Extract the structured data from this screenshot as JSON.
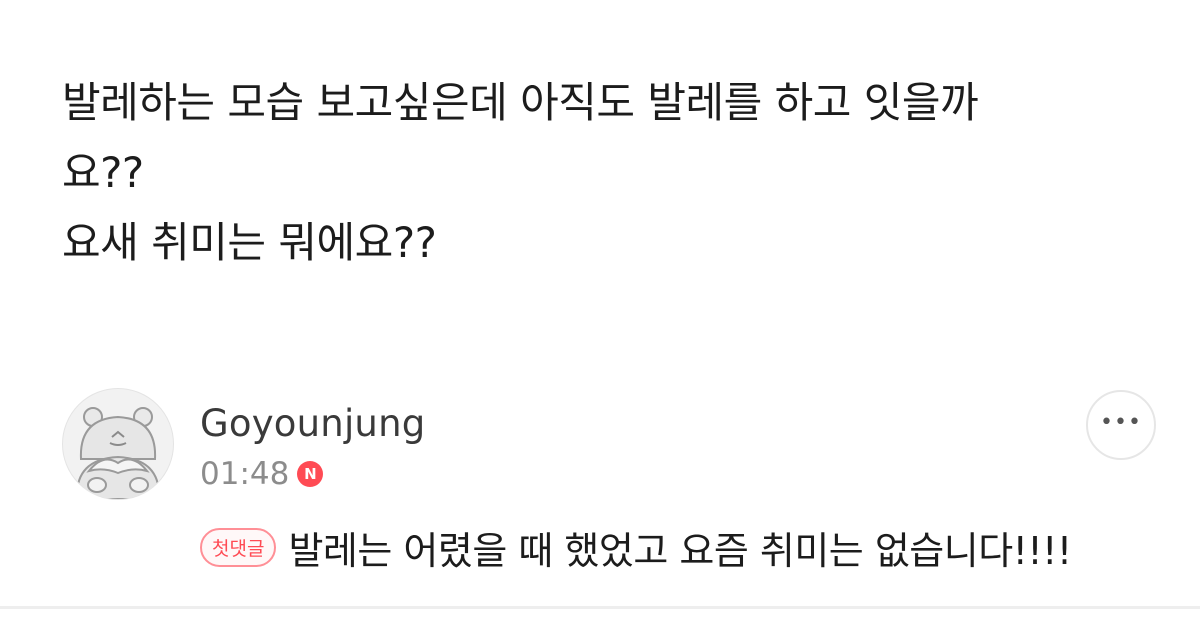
{
  "post": {
    "lines": [
      "발레하는 모습 보고싶은데 아직도 발레를 하고 잇을까",
      "요??",
      "요새 취미는 뭐에요??"
    ]
  },
  "comment": {
    "author": "Goyounjung",
    "time": "01:48",
    "new_badge": "N",
    "first_comment_badge": "첫댓글",
    "text": "발레는 어렸을 때 했었고 요즘 취미는 없습니다!!!!",
    "more_icon": "more-horizontal-icon",
    "avatar_icon": "bear-avatar-icon"
  },
  "colors": {
    "accent_red": "#ff4b54",
    "muted_text": "#8c8c8c",
    "divider": "#eeeeee"
  }
}
